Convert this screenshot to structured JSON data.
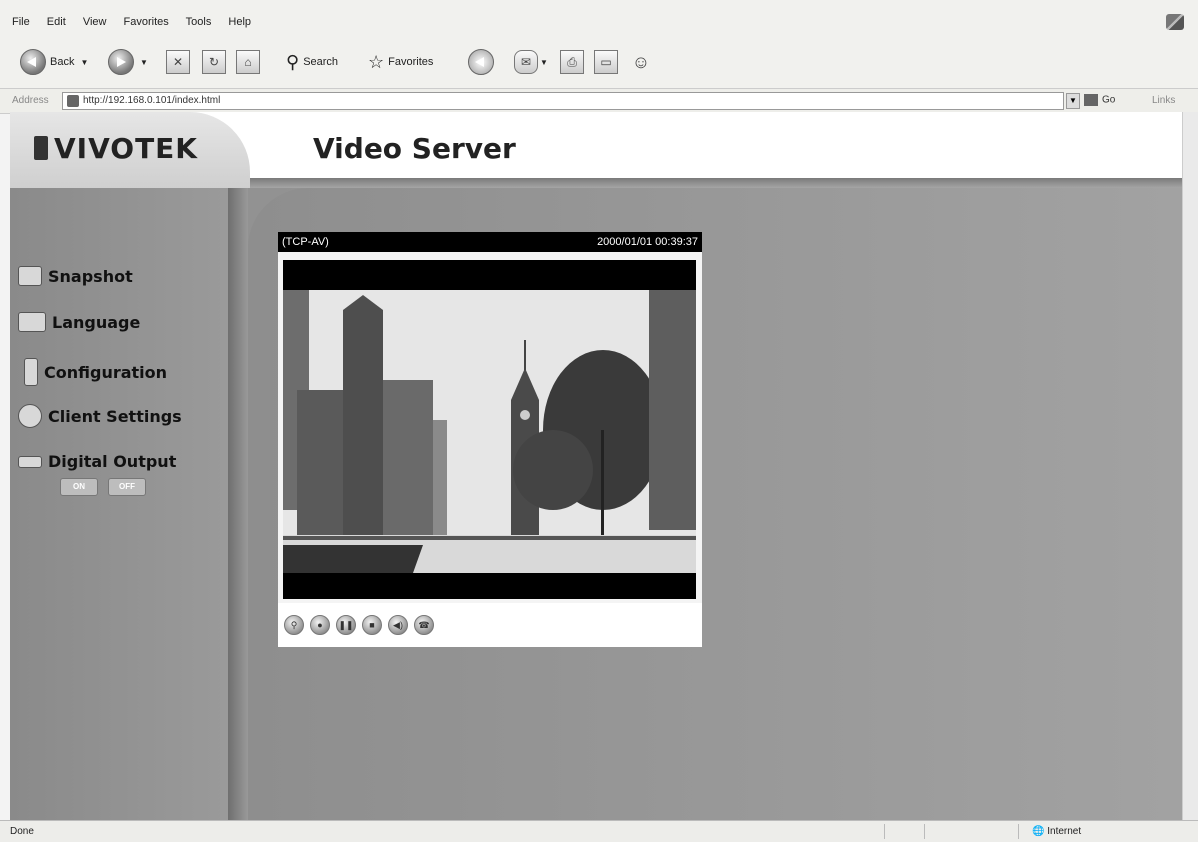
{
  "browser": {
    "menu": [
      "File",
      "Edit",
      "View",
      "Favorites",
      "Tools",
      "Help"
    ],
    "toolbar": {
      "back": "Back",
      "search": "Search",
      "favorites": "Favorites"
    },
    "address_label": "Address",
    "url": "http://192.168.0.101/index.html",
    "go": "Go",
    "links": "Links",
    "status_left": "Done",
    "status_zone": "Internet"
  },
  "page": {
    "logo": "VIVOTEK",
    "title": "Video Server",
    "nav": [
      {
        "label": "Snapshot",
        "icon": "camera-icon"
      },
      {
        "label": "Language",
        "icon": "language-icon"
      },
      {
        "label": "Configuration",
        "icon": "tools-icon"
      },
      {
        "label": "Client Settings",
        "icon": "disc-icon"
      },
      {
        "label": "Digital Output",
        "icon": "switch-icon"
      }
    ],
    "digital_output": {
      "on": "ON",
      "off": "OFF"
    },
    "video": {
      "protocol": "(TCP-AV)",
      "timestamp": "2000/01/01 00:39:37"
    },
    "controls": [
      "zoom-icon",
      "record-icon",
      "pause-icon",
      "stop-icon",
      "volume-icon",
      "talk-icon"
    ]
  }
}
